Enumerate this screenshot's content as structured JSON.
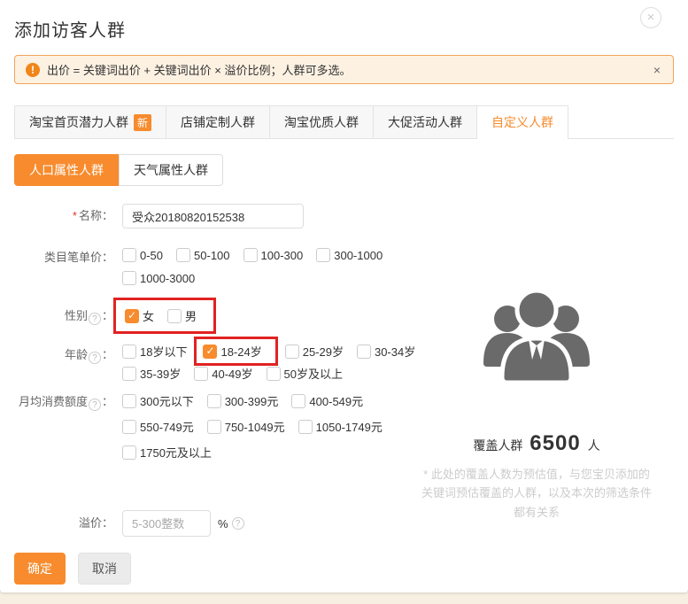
{
  "colors": {
    "accent": "#f78b2d",
    "highlight_red": "#e12222",
    "alert_bg": "#fdf1e2",
    "alert_border": "#f0a45a"
  },
  "dialog": {
    "title": "添加访客人群",
    "close_glyph": "×",
    "alert": {
      "text": "出价 = 关键词出价 + 关键词出价 × 溢价比例；人群可多选。",
      "close_glyph": "×"
    },
    "tabs": [
      {
        "label": "淘宝首页潜力人群",
        "badge": "新",
        "active": false
      },
      {
        "label": "店铺定制人群",
        "active": false
      },
      {
        "label": "淘宝优质人群",
        "active": false
      },
      {
        "label": "大促活动人群",
        "active": false
      },
      {
        "label": "自定义人群",
        "active": true
      }
    ],
    "subtabs": [
      {
        "label": "人口属性人群",
        "active": true
      },
      {
        "label": "天气属性人群",
        "active": false
      }
    ],
    "form": {
      "colon": "：",
      "name": {
        "star": "*",
        "label": "名称",
        "value": "受众20180820152538"
      },
      "category_price": {
        "label": "类目笔单价",
        "options": [
          {
            "label": "0-50",
            "checked": false
          },
          {
            "label": "50-100",
            "checked": false
          },
          {
            "label": "100-300",
            "checked": false
          },
          {
            "label": "300-1000",
            "checked": false
          },
          {
            "label": "1000-3000",
            "checked": false
          }
        ]
      },
      "gender": {
        "label": "性别",
        "options": [
          {
            "label": "女",
            "checked": true
          },
          {
            "label": "男",
            "checked": false
          }
        ]
      },
      "age": {
        "label": "年龄",
        "options": [
          {
            "label": "18岁以下",
            "checked": false
          },
          {
            "label": "18-24岁",
            "checked": true
          },
          {
            "label": "25-29岁",
            "checked": false
          },
          {
            "label": "30-34岁",
            "checked": false
          },
          {
            "label": "35-39岁",
            "checked": false
          },
          {
            "label": "40-49岁",
            "checked": false
          },
          {
            "label": "50岁及以上",
            "checked": false
          }
        ]
      },
      "monthly_spend": {
        "label": "月均消费额度",
        "options": [
          {
            "label": "300元以下",
            "checked": false
          },
          {
            "label": "300-399元",
            "checked": false
          },
          {
            "label": "400-549元",
            "checked": false
          },
          {
            "label": "550-749元",
            "checked": false
          },
          {
            "label": "750-1049元",
            "checked": false
          },
          {
            "label": "1050-1749元",
            "checked": false
          },
          {
            "label": "1750元及以上",
            "checked": false
          }
        ]
      },
      "premium": {
        "label": "溢价",
        "placeholder": "5-300整数",
        "unit": "%"
      }
    },
    "coverage": {
      "label": "覆盖人群",
      "value": "6500",
      "unit": "人",
      "note_lines": [
        "* 此处的覆盖人数为预估值，与您宝贝添加的",
        "关键词预估覆盖的人群，以及本次的筛选条件",
        "都有关系"
      ]
    },
    "footer": {
      "confirm": "确定",
      "cancel": "取消"
    }
  }
}
